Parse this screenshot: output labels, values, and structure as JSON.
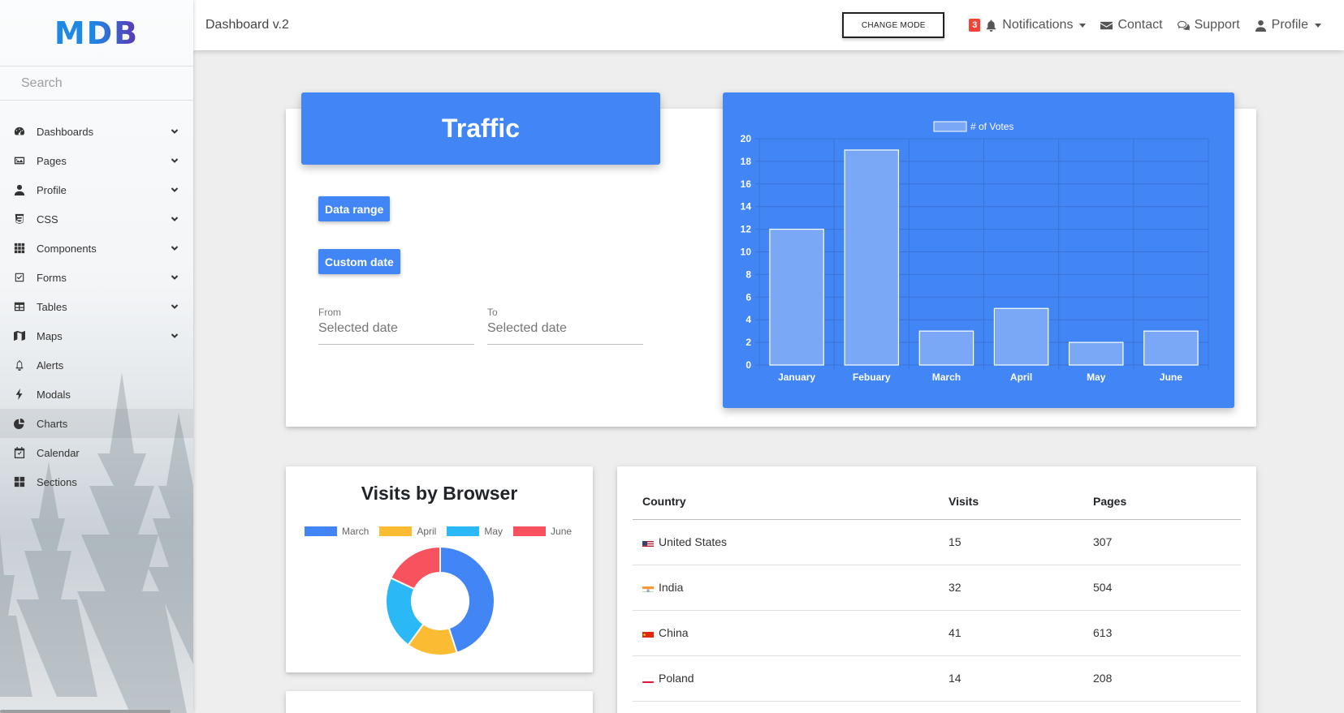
{
  "sidebar": {
    "logo": "MDB",
    "search_placeholder": "Search",
    "items": [
      {
        "label": "Dashboards",
        "icon": "tachometer-icon",
        "expandable": true
      },
      {
        "label": "Pages",
        "icon": "image-icon",
        "expandable": true
      },
      {
        "label": "Profile",
        "icon": "user-icon",
        "expandable": true
      },
      {
        "label": "CSS",
        "icon": "css3-icon",
        "expandable": true
      },
      {
        "label": "Components",
        "icon": "th-icon",
        "expandable": true
      },
      {
        "label": "Forms",
        "icon": "check-square-icon",
        "expandable": true
      },
      {
        "label": "Tables",
        "icon": "table-icon",
        "expandable": true
      },
      {
        "label": "Maps",
        "icon": "map-icon",
        "expandable": true
      },
      {
        "label": "Alerts",
        "icon": "bell-icon",
        "expandable": false
      },
      {
        "label": "Modals",
        "icon": "bolt-icon",
        "expandable": false
      },
      {
        "label": "Charts",
        "icon": "pie-chart-icon",
        "expandable": false,
        "active": true
      },
      {
        "label": "Calendar",
        "icon": "calendar-check-icon",
        "expandable": false
      },
      {
        "label": "Sections",
        "icon": "th-large-icon",
        "expandable": false
      }
    ]
  },
  "topnav": {
    "title": "Dashboard v.2",
    "change_mode": "CHANGE MODE",
    "notifications_count": "3",
    "notifications": "Notifications",
    "contact": "Contact",
    "support": "Support",
    "profile": "Profile"
  },
  "traffic": {
    "title": "Traffic",
    "data_range": "Data range",
    "custom_date": "Custom date",
    "from_label": "From",
    "from_placeholder": "Selected date",
    "to_label": "To",
    "to_placeholder": "Selected date"
  },
  "chart_data": [
    {
      "type": "bar",
      "categories": [
        "January",
        "Febuary",
        "March",
        "April",
        "May",
        "June"
      ],
      "series": [
        {
          "name": "# of Votes",
          "values": [
            12,
            19,
            3,
            5,
            2,
            3
          ]
        }
      ],
      "ylim": [
        0,
        20
      ],
      "yticks": [
        0,
        2,
        4,
        6,
        8,
        10,
        12,
        14,
        16,
        18,
        20
      ],
      "legend": "top",
      "grid": true,
      "colors": {
        "bar_fill": "#7ba8f6",
        "bar_stroke": "#ffffff",
        "background": "#4285f4",
        "grid": "#3a74d8",
        "text": "#ffffff"
      }
    },
    {
      "type": "pie",
      "title": "Visits by Browser",
      "categories": [
        "March",
        "April",
        "May",
        "June"
      ],
      "values": [
        45,
        15,
        22,
        18
      ],
      "donut": true,
      "legend": "top",
      "colors": [
        "#4285f4",
        "#fbbc34",
        "#2bb8f7",
        "#f7525e"
      ]
    }
  ],
  "table": {
    "headers": [
      "Country",
      "Visits",
      "Pages"
    ],
    "rows": [
      {
        "country": "United States",
        "visits": "15",
        "pages": "307",
        "flag": "us"
      },
      {
        "country": "India",
        "visits": "32",
        "pages": "504",
        "flag": "in"
      },
      {
        "country": "China",
        "visits": "41",
        "pages": "613",
        "flag": "cn"
      },
      {
        "country": "Poland",
        "visits": "14",
        "pages": "208",
        "flag": "pl"
      }
    ]
  }
}
